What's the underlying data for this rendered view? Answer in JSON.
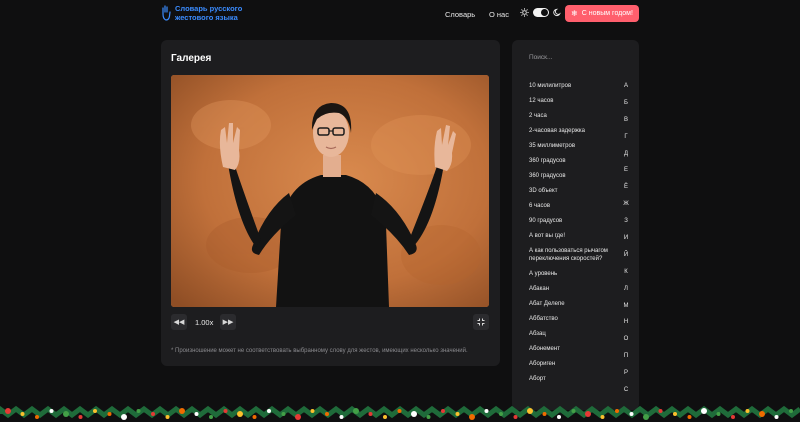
{
  "header": {
    "logo_text": "Словарь русского жестового языка",
    "nav": [
      {
        "label": "Словарь"
      },
      {
        "label": "О нас"
      }
    ],
    "new_year_button": "С новым годом!"
  },
  "gallery": {
    "title": "Галерея",
    "speed": "1.00x",
    "note": "* Произношение может не соответствовать выбранному слову для жестов, имеющих несколько значений."
  },
  "sidebar": {
    "search_placeholder": "Поиск...",
    "words": [
      "10 милилитров",
      "12 часов",
      "2 часа",
      "2-часовая задержка",
      "35 миллиметров",
      "360 градусов",
      "360 градусов",
      "3D объект",
      "6 часов",
      "90 градусов",
      "А вот вы где!",
      "А как пользоваться рычагом переключения скоростей?",
      "А уровень",
      "Абакан",
      "Абат Делепе",
      "Аббатство",
      "Абзац",
      "Абонемент",
      "Абориген",
      "Аборт"
    ],
    "letters": [
      "А",
      "Б",
      "В",
      "Г",
      "Д",
      "Е",
      "Ё",
      "Ж",
      "З",
      "И",
      "Й",
      "К",
      "Л",
      "М",
      "Н",
      "О",
      "П",
      "Р",
      "С"
    ]
  },
  "colors": {
    "background": "#0f0f10",
    "card": "#1d1d1f",
    "accent_blue": "#3b8cff",
    "new_year_button": "#ff5f6d",
    "video_backdrop": "#c7773c"
  },
  "icons": {
    "logo": "hand-sign-icon",
    "theme_light": "sun-icon",
    "theme_dark": "moon-icon",
    "new_year": "snowflake-icon",
    "rewind": "rewind-icon",
    "forward": "fast-forward-icon",
    "fullscreen": "fullscreen-exit-icon"
  }
}
